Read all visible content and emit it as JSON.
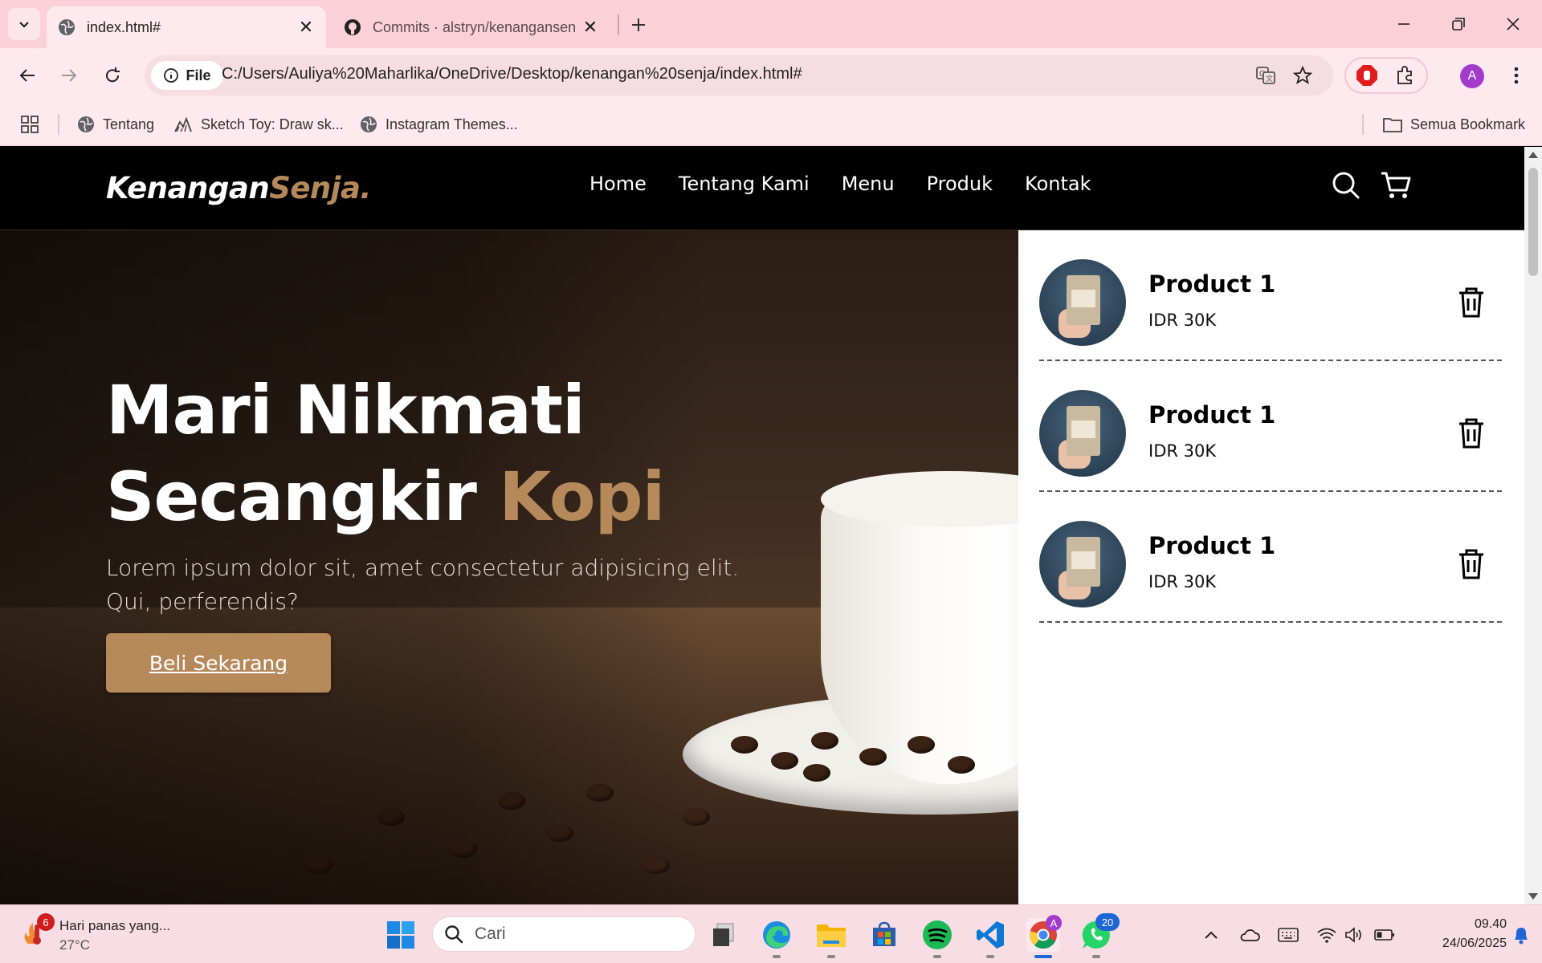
{
  "browser": {
    "tabs": [
      {
        "title": "index.html#",
        "active": true
      },
      {
        "title": "Commits · alstryn/kenangansen",
        "active": false
      }
    ],
    "url_chip": "File",
    "url": "C:/Users/Auliya%20Maharlika/OneDrive/Desktop/kenangan%20senja/index.html#",
    "profile_initial": "A",
    "bookmarks": [
      {
        "label": "Tentang",
        "icon": "globe-icon"
      },
      {
        "label": "Sketch Toy: Draw sk...",
        "icon": "sketch-toy-icon"
      },
      {
        "label": "Instagram Themes...",
        "icon": "globe-icon"
      }
    ],
    "all_bookmarks": "Semua Bookmark"
  },
  "site": {
    "logo_main": "Kenangan",
    "logo_accent": "Senja.",
    "nav": [
      "Home",
      "Tentang Kami",
      "Menu",
      "Produk",
      "Kontak"
    ],
    "hero": {
      "title_line1": "Mari Nikmati",
      "title_line2_main": "Secangkir ",
      "title_line2_accent": "Kopi",
      "subtitle": "Lorem ipsum dolor sit, amet consectetur adipisicing elit. Qui, perferendis?",
      "cta": "Beli Sekarang"
    },
    "cart": [
      {
        "name": "Product 1",
        "price": "IDR 30K"
      },
      {
        "name": "Product 1",
        "price": "IDR 30K"
      },
      {
        "name": "Product 1",
        "price": "IDR 30K"
      }
    ],
    "colors": {
      "accent": "#b6895b",
      "nav_bg": "#000000",
      "cart_bg": "#ffffff"
    }
  },
  "taskbar": {
    "weather_badge": "6",
    "weather_title": "Hari panas yang...",
    "weather_temp": "27°C",
    "search_placeholder": "Cari",
    "whatsapp_badge": "20",
    "chrome_profile_badge": "A",
    "time": "09.40",
    "date": "24/06/2025"
  }
}
